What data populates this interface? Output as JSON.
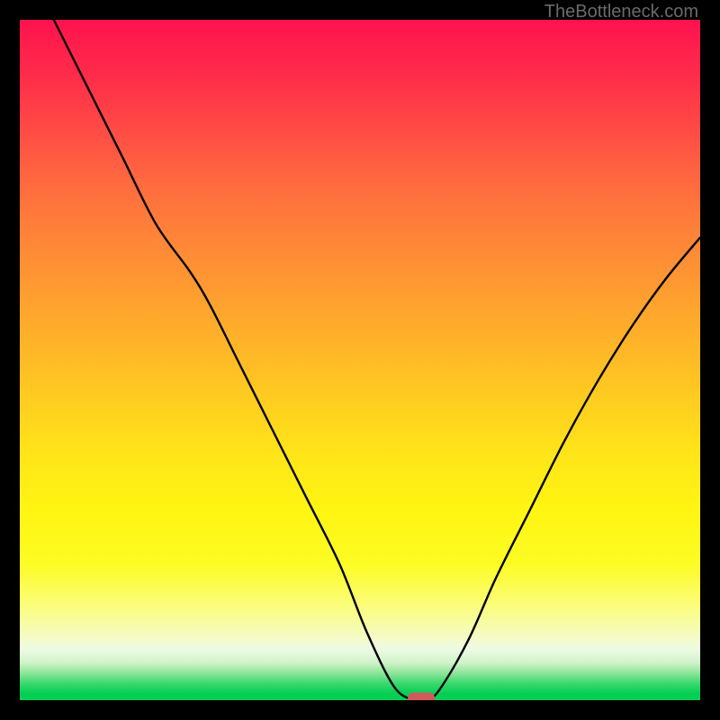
{
  "watermark": "TheBottleneck.com",
  "chart_data": {
    "type": "line",
    "title": "",
    "xlabel": "",
    "ylabel": "",
    "xlim": [
      0,
      100
    ],
    "ylim": [
      0,
      100
    ],
    "grid": false,
    "legend": false,
    "background": "red-yellow-green vertical gradient",
    "series": [
      {
        "name": "bottleneck-curve",
        "x": [
          5,
          10,
          15,
          20,
          25,
          28,
          32,
          37,
          42,
          47,
          51,
          55,
          58,
          60,
          62,
          66,
          70,
          75,
          80,
          85,
          90,
          95,
          100
        ],
        "values": [
          100,
          90,
          80,
          70,
          63,
          58,
          50,
          40,
          30,
          20,
          10,
          2,
          0,
          0,
          2,
          9,
          18,
          28,
          38,
          47,
          55,
          62,
          68
        ]
      }
    ],
    "marker": {
      "name": "optimal-point",
      "x": 59,
      "y": 0,
      "color": "#d05a5a",
      "shape": "rounded-rect"
    }
  }
}
